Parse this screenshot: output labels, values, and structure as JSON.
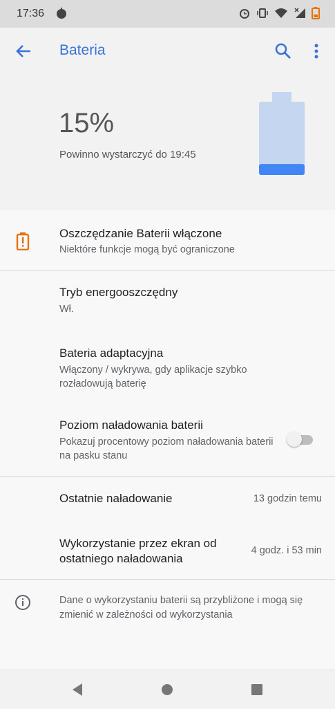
{
  "status_bar": {
    "time": "17:36"
  },
  "app_bar": {
    "title": "Bateria"
  },
  "battery": {
    "percent": "15%",
    "estimate": "Powinno wystarczyć do 19:45",
    "level": 0.15
  },
  "settings": {
    "saver": {
      "title": "Oszczędzanie Baterii włączone",
      "subtitle": "Niektóre funkcje mogą być ograniczone"
    },
    "power_mode": {
      "title": "Tryb energooszczędny",
      "subtitle": "Wł."
    },
    "adaptive": {
      "title": "Bateria adaptacyjna",
      "subtitle": "Włączony / wykrywa, gdy aplikacje szybko rozładowują baterię"
    },
    "percentage": {
      "title": "Poziom naładowania baterii",
      "subtitle": "Pokazuj procentowy poziom naładowania baterii na pasku stanu",
      "enabled": false
    },
    "last_charge": {
      "title": "Ostatnie naładowanie",
      "value": "13 godzin temu"
    },
    "screen_usage": {
      "title": "Wykorzystanie przez ekran od ostatniego naładowania",
      "value": "4 godz. i 53 min"
    },
    "info": {
      "text": "Dane o wykorzystaniu baterii są przybliżone i mogą się zmienić w zależności od wykorzystania"
    }
  },
  "colors": {
    "accent": "#3a73d6",
    "saver_icon": "#e8710a",
    "battery_empty": "#c5d6f0",
    "battery_fill": "#4285f4"
  }
}
